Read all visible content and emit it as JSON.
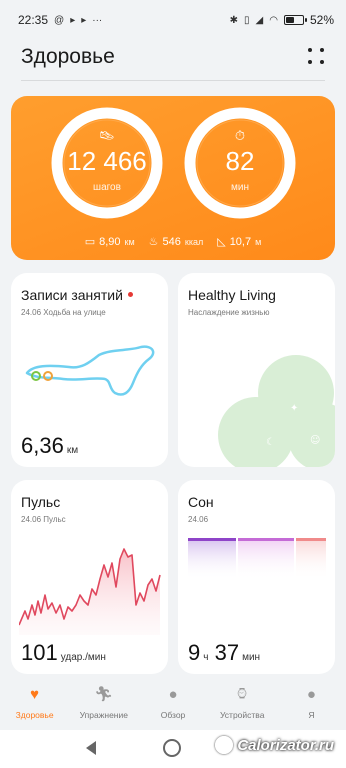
{
  "status": {
    "time": "22:35",
    "battery": "52",
    "battery_level": 0.52
  },
  "header": {
    "title": "Здоровье"
  },
  "activity": {
    "steps": {
      "value": "12 466",
      "unit": "шагов"
    },
    "minutes": {
      "value": "82",
      "unit": "мин"
    },
    "distance": {
      "value": "8,90",
      "unit": "км"
    },
    "calories": {
      "value": "546",
      "unit": "ккал"
    },
    "floors": {
      "value": "10,7",
      "unit": "м"
    }
  },
  "workouts": {
    "title": "Записи занятий",
    "sub": "24.06 Ходьба на улице",
    "value": "6,36",
    "unit": "км"
  },
  "healthy": {
    "title": "Healthy Living",
    "sub": "Наслаждение жизнью"
  },
  "pulse": {
    "title": "Пульс",
    "sub": "24.06 Пульс",
    "value": "101",
    "unit": "удар./мин"
  },
  "sleep": {
    "title": "Сон",
    "sub": "24.06",
    "hours": "9",
    "hours_unit": "ч",
    "minutes": "37",
    "minutes_unit": "мин"
  },
  "tabs": [
    {
      "label": "Здоровье",
      "icon": "heart-pulse-icon",
      "active": true
    },
    {
      "label": "Упражнение",
      "icon": "running-icon",
      "active": false
    },
    {
      "label": "Обзор",
      "icon": "globe-icon",
      "active": false
    },
    {
      "label": "Устройства",
      "icon": "watch-icon",
      "active": false
    },
    {
      "label": "Я",
      "icon": "user-icon",
      "active": false
    }
  ],
  "watermark": "Calorizator.ru",
  "colors": {
    "accent": "#ff7a1a",
    "hero": "#ff9526",
    "pulse_line": "#e0485e",
    "sleep_deep": "#8e44c8",
    "sleep_light": "#c46bd6",
    "sleep_rem": "#f08a8a",
    "route": "#6fd0f0"
  }
}
